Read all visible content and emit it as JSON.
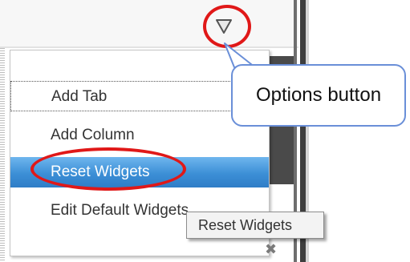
{
  "menu": {
    "items": [
      {
        "label": "Add Tab"
      },
      {
        "label": "Add Column"
      },
      {
        "label": "Reset Widgets",
        "highlighted": true
      },
      {
        "label": "Edit Default Widgets"
      }
    ]
  },
  "options_button": {
    "icon": "triangle-down-icon"
  },
  "callout": {
    "text": "Options button"
  },
  "tooltip": {
    "text": "Reset Widgets"
  },
  "colors": {
    "highlight": "#3c8fd6",
    "annotation_red": "#e01818",
    "callout_border": "#6a8fd8"
  }
}
